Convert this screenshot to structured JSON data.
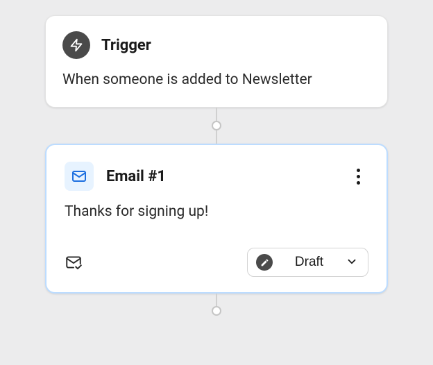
{
  "trigger": {
    "title": "Trigger",
    "description": "When someone is added to Newsletter"
  },
  "email": {
    "title": "Email #1",
    "description": "Thanks for signing up!",
    "status": {
      "label": "Draft"
    }
  },
  "colors": {
    "canvas": "#ececed",
    "emailBorder": "#bcdcff",
    "emailIconBg": "#e7f3ff",
    "emailIconStroke": "#1c6fe0",
    "triggerIconBg": "#4a4a4a"
  }
}
